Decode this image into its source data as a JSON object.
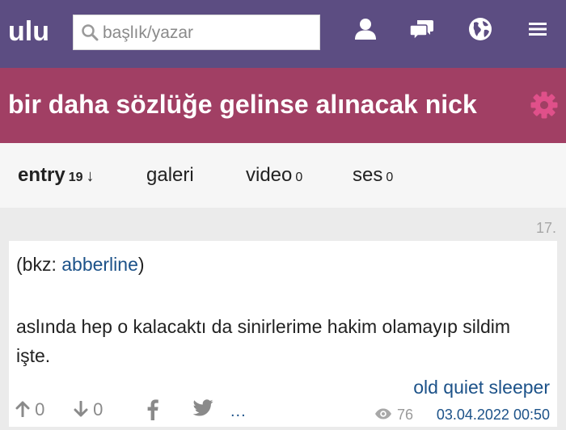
{
  "header": {
    "logo": "ulu",
    "search_placeholder": "başlık/yazar",
    "icons": [
      "user-icon",
      "messages-icon",
      "globe-icon",
      "menu-icon"
    ]
  },
  "topic": {
    "title": "bir daha sözlüğe gelinse alınacak nick",
    "settings_icon": "gear-icon"
  },
  "tabs": {
    "entry": {
      "label": "entry",
      "count": "19",
      "sort_symbol": "↓"
    },
    "galeri": {
      "label": "galeri"
    },
    "video": {
      "label": "video",
      "count": "0"
    },
    "ses": {
      "label": "ses",
      "count": "0"
    }
  },
  "entry": {
    "number": "17.",
    "bkz_prefix": "(bkz: ",
    "bkz_link": "abberline",
    "bkz_suffix": ")",
    "text": "aslında hep o kalacaktı da sinirlerime hakim olamayıp sildim işte.",
    "author": "old quiet sleeper",
    "upvotes": "0",
    "downvotes": "0",
    "more": "...",
    "views": "76",
    "date": "03.04.2022 00:50"
  },
  "colors": {
    "header_bg": "#5c4d82",
    "title_bg": "#a13f64",
    "gear": "#e0508a",
    "link": "#1c5289",
    "tabs_bg": "#f6f6f6",
    "page_bg": "#ebebeb"
  }
}
